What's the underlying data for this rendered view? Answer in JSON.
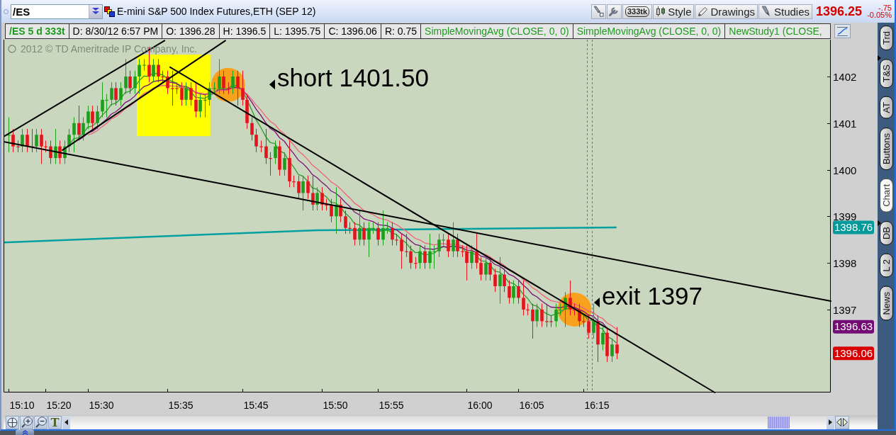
{
  "toolbar": {
    "symbol_field": {
      "value": "/ES"
    },
    "title": "E-mini S&P 500 Index Futures,ETH (SEP 12)",
    "buttons": [
      {
        "kind": "tick",
        "label": "333tk"
      },
      {
        "kind": "text",
        "label": "Style"
      },
      {
        "kind": "text",
        "label": "Drawings"
      },
      {
        "kind": "text",
        "label": "Studies"
      }
    ],
    "last_price": "1396.25",
    "net_change": "-.75",
    "percent_change": "-0.05%"
  },
  "info_cells": [
    {
      "kind": "symbol",
      "text": "/ES 5 d 333t"
    },
    {
      "kind": "quote",
      "text": "D: 8/30/12 6:57 PM"
    },
    {
      "kind": "quote",
      "text": "O: 1396.28"
    },
    {
      "kind": "quote",
      "text": "H: 1396.5"
    },
    {
      "kind": "quote",
      "text": "L: 1395.75"
    },
    {
      "kind": "quote",
      "text": "C: 1396.06"
    },
    {
      "kind": "quote",
      "text": "R: 0.75"
    },
    {
      "kind": "study",
      "text": "SimpleMovingAvg (CLOSE, 0, 0)"
    },
    {
      "kind": "study",
      "text": "SimpleMovingAvg (CLOSE, 0, 0)"
    },
    {
      "kind": "study",
      "text": "NewStudy1 (CLOSE,"
    }
  ],
  "chart": {
    "copyright": "2012 © TD Ameritrade IP Company, Inc.",
    "price_labels": [
      "1402",
      "1401",
      "1400",
      "1399",
      "1398",
      "1397"
    ],
    "time_labels": [
      "15:10",
      "15:20",
      "15:30",
      "15:35",
      "15:45",
      "15:50",
      "15:55",
      "16:00",
      "16:05",
      "16:15"
    ],
    "annotations": [
      "short 1401.50",
      "exit 1397"
    ],
    "price_badges": [
      {
        "label": "1398.76",
        "color": "#009a9a"
      },
      {
        "label": "1396.63",
        "color": "#740a74"
      },
      {
        "label": "1396.06",
        "color": "#d80000"
      }
    ]
  },
  "side_tabs": [
    {
      "label": "Trd",
      "selected": false
    },
    {
      "label": "T&S",
      "selected": false
    },
    {
      "label": "AT",
      "selected": false
    },
    {
      "label": "Buttons",
      "selected": false
    },
    {
      "label": "Chart",
      "selected": true
    },
    {
      "label": "DB",
      "selected": false
    },
    {
      "label": "L 2",
      "selected": false
    },
    {
      "label": "News",
      "selected": false
    }
  ],
  "bottom_toolbar": {
    "text_tool": "T"
  }
}
